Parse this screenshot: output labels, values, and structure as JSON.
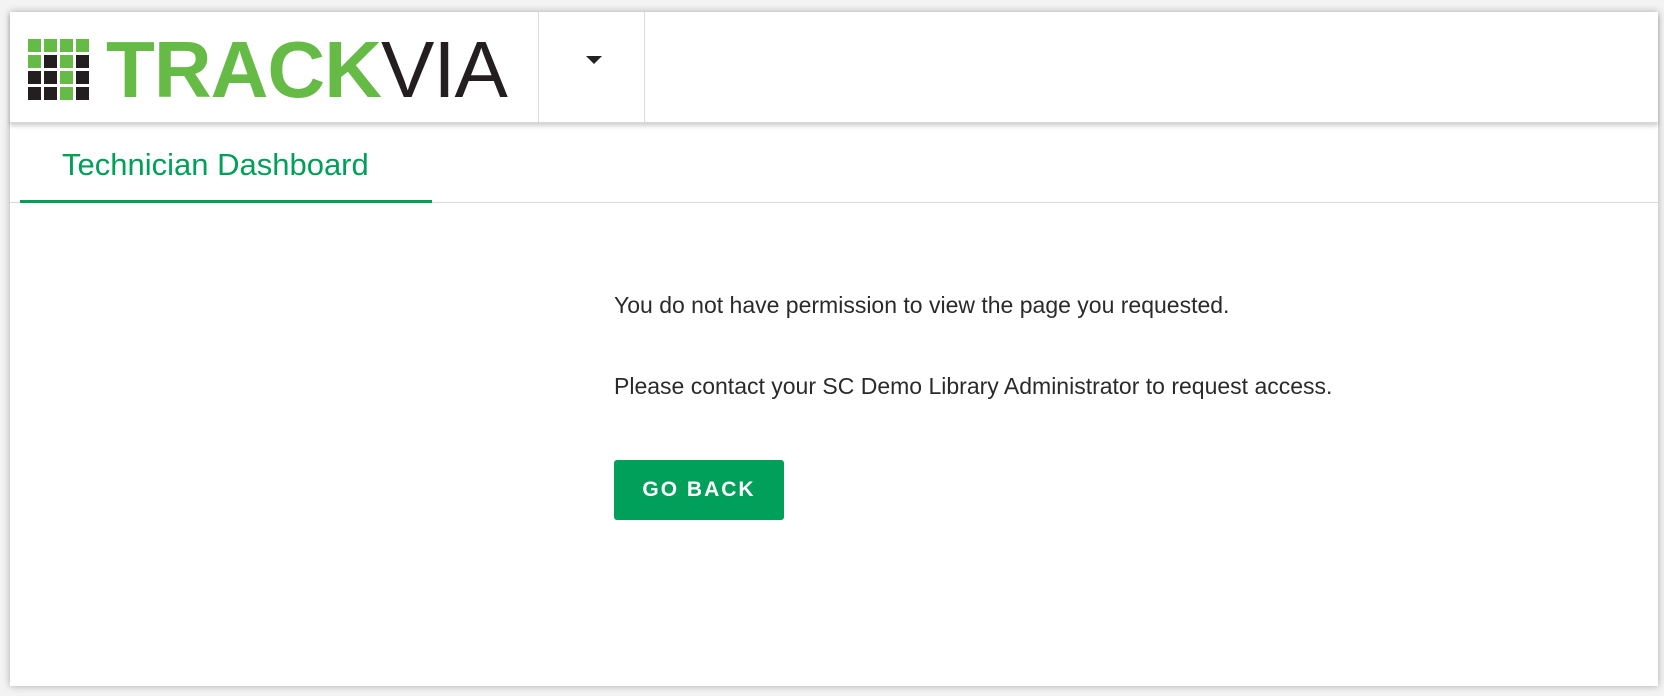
{
  "header": {
    "logo": {
      "text_primary": "TRACK",
      "text_secondary": "VIA",
      "brand_green": "#66bb46",
      "brand_dark": "#231f20"
    },
    "app_switcher_icon": "caret-down-icon"
  },
  "tabs": [
    {
      "label": "Technician Dashboard",
      "active": true
    }
  ],
  "main": {
    "permission_message": "You do not have permission to view the page you requested.",
    "contact_message": "Please contact your SC Demo Library Administrator to request access.",
    "go_back_label": "GO BACK"
  },
  "colors": {
    "accent": "#00a05a",
    "text": "#2a2a2a",
    "background": "#ffffff"
  }
}
